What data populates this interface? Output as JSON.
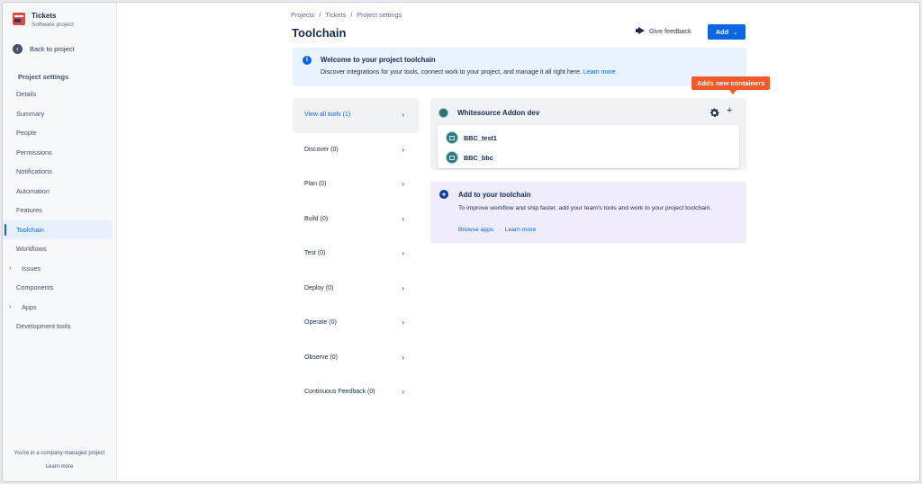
{
  "sidebar": {
    "project_name": "Tickets",
    "project_type": "Software project",
    "back_label": "Back to project",
    "section_title": "Project settings",
    "items": [
      {
        "label": "Details"
      },
      {
        "label": "Summary"
      },
      {
        "label": "People"
      },
      {
        "label": "Permissions"
      },
      {
        "label": "Notifications"
      },
      {
        "label": "Automation"
      },
      {
        "label": "Features"
      },
      {
        "label": "Toolchain",
        "active": true
      },
      {
        "label": "Workflows"
      },
      {
        "label": "Issues",
        "expandable": true
      },
      {
        "label": "Components"
      },
      {
        "label": "Apps",
        "expandable": true
      },
      {
        "label": "Development tools"
      }
    ],
    "company_note": "You're in a company-managed project",
    "learn_more": "Learn more"
  },
  "breadcrumb": [
    "Projects",
    "Tickets",
    "Project settings"
  ],
  "page_title": "Toolchain",
  "header": {
    "feedback_label": "Give feedback",
    "add_label": "Add"
  },
  "welcome": {
    "title": "Welcome to your project toolchain",
    "description": "Discover integrations for your tools, connect work to your project, and manage it all right here.",
    "link": "Learn more"
  },
  "categories": [
    {
      "label": "View all tools (1)",
      "active": true
    },
    {
      "label": "Discover (0)"
    },
    {
      "label": "Plan (0)"
    },
    {
      "label": "Build (0)"
    },
    {
      "label": "Test (0)"
    },
    {
      "label": "Deploy (0)"
    },
    {
      "label": "Operate (0)"
    },
    {
      "label": "Observe (0)"
    },
    {
      "label": "Continuous Feedback (0)"
    }
  ],
  "tool_card": {
    "title": "Whitesource Addon dev",
    "containers": [
      {
        "name": "BBC_test1"
      },
      {
        "name": "BBC_bbc"
      }
    ]
  },
  "tooltip": "Adds new containers",
  "add_toolchain": {
    "title": "Add to your toolchain",
    "description": "To improve workflow and ship faster, add your team's tools and work to your project toolchain.",
    "browse": "Browse apps",
    "learn": "Learn more"
  },
  "colors": {
    "primary": "#0c66e4",
    "tooltip": "#f1592a",
    "welcome_bg": "#e9f2ff",
    "add_bg": "#f0ecfd"
  }
}
